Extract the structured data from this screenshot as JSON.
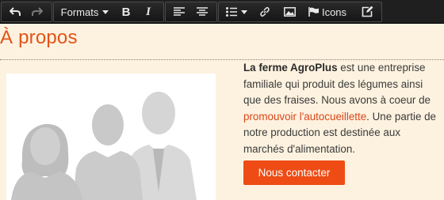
{
  "toolbar": {
    "formats_label": "Formats",
    "bold_label": "B",
    "italic_label": "I",
    "icons_label": "Icons",
    "icons": [
      "undo-icon",
      "redo-icon",
      "align-left-icon",
      "align-center-icon",
      "list-icon",
      "link-icon",
      "image-icon",
      "flag-icon",
      "edit-icon"
    ]
  },
  "page": {
    "title": "À propos"
  },
  "about": {
    "company": "La ferme AgroPlus",
    "text_1": " est une entreprise familiale qui produit des légumes ainsi que des fraises. Nous avons à coeur de ",
    "link_1": "promouvoir",
    "space": " ",
    "link_2": "l'autocueillette",
    "text_2": ". Une partie de notre production est destinée aux marchés d'alimentation."
  },
  "cta": {
    "label": "Nous contacter"
  },
  "colors": {
    "accent": "#e2531a",
    "button": "#ee4c14",
    "background": "#fdf2df",
    "toolbar": "#1f1f1f"
  }
}
